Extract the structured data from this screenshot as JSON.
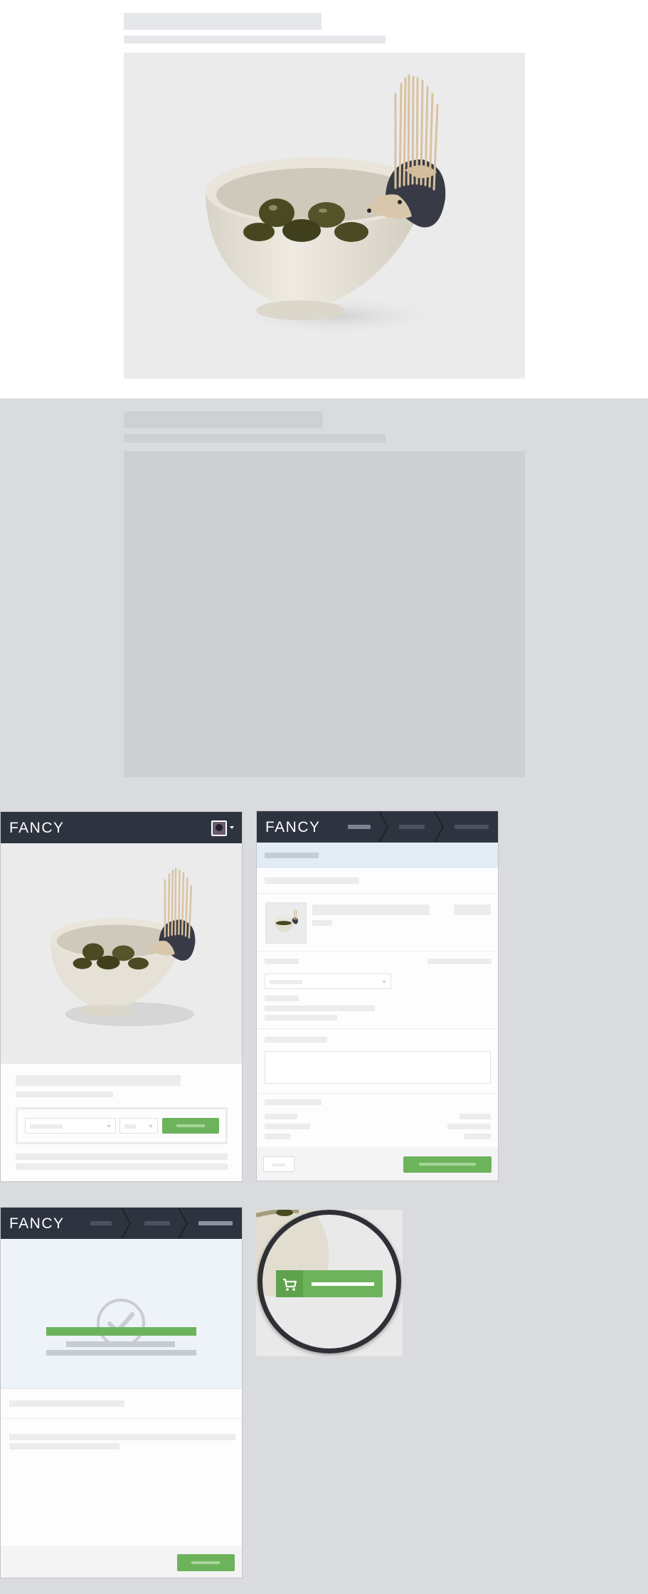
{
  "brand": {
    "name": "FANCY"
  },
  "colors": {
    "page_background": "#dadbde",
    "header_dark": "#2e3340",
    "accent_green": "#6db35c",
    "confirmation_bg": "#eef2f9"
  },
  "icons": {
    "check": "check-circle-icon",
    "cart": "shopping-cart-icon",
    "caret": "chevron-down-icon",
    "avatar": "user-avatar-icon"
  },
  "screens": {
    "product_card": {
      "header_title": "FANCY",
      "has_avatar": true
    },
    "checkout_card": {
      "header_title": "FANCY",
      "steps": 3,
      "active_step": 1
    },
    "confirmation_card": {
      "header_title": "FANCY",
      "steps": 3,
      "active_step": 3
    }
  }
}
